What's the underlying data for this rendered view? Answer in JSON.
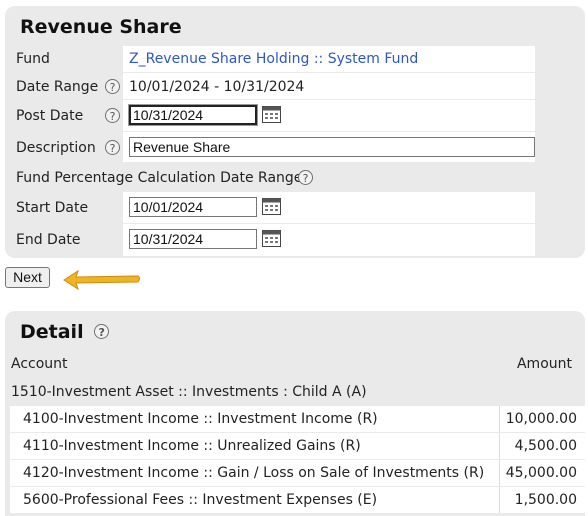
{
  "revenue_share": {
    "title": "Revenue Share",
    "fund_label": "Fund",
    "fund_value": "Z_Revenue Share Holding :: System Fund",
    "date_range_label": "Date Range",
    "date_range_value": "10/01/2024 - 10/31/2024",
    "post_date_label": "Post Date",
    "post_date_value": "10/31/2024",
    "description_label": "Description",
    "description_value": "Revenue Share",
    "calc_range_label": "Fund Percentage Calculation Date Range",
    "start_date_label": "Start Date",
    "start_date_value": "10/01/2024",
    "end_date_label": "End Date",
    "end_date_value": "10/31/2024",
    "next_label": "Next"
  },
  "detail": {
    "title": "Detail",
    "col_account": "Account",
    "col_amount": "Amount",
    "group": "1510-Investment Asset :: Investments : Child A (A)",
    "rows": [
      {
        "account": "4100-Investment Income :: Investment Income (R)",
        "amount": "10,000.00"
      },
      {
        "account": "4110-Investment Income :: Unrealized Gains (R)",
        "amount": "4,500.00"
      },
      {
        "account": "4120-Investment Income :: Gain / Loss on Sale of Investments (R)",
        "amount": "45,000.00"
      },
      {
        "account": "5600-Professional Fees :: Investment Expenses (E)",
        "amount": "1,500.00"
      }
    ]
  },
  "icons": {
    "help": "question-circle-icon",
    "calendar": "calendar-icon",
    "arrow": "arrow-left-icon",
    "arrow_color": "#f0b323",
    "link_color": "#2d57c8"
  }
}
